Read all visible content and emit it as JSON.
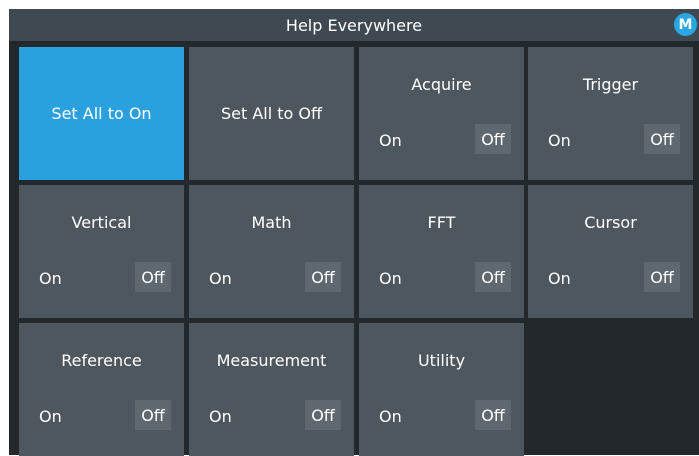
{
  "window": {
    "title": "Help Everywhere",
    "badge": "M"
  },
  "actions": {
    "set_all_on": "Set All to On",
    "set_all_off": "Set All to Off"
  },
  "options": {
    "on": "On",
    "off": "Off"
  },
  "categories": [
    {
      "name": "Acquire",
      "state": "Off"
    },
    {
      "name": "Trigger",
      "state": "Off"
    },
    {
      "name": "Vertical",
      "state": "Off"
    },
    {
      "name": "Math",
      "state": "Off"
    },
    {
      "name": "FFT",
      "state": "Off"
    },
    {
      "name": "Cursor",
      "state": "Off"
    },
    {
      "name": "Reference",
      "state": "Off"
    },
    {
      "name": "Measurement",
      "state": "Off"
    },
    {
      "name": "Utility",
      "state": "Off"
    }
  ],
  "colors": {
    "accent": "#2aa0de",
    "tile": "#4f575e",
    "background": "#22282c",
    "titlebar": "#3f4951"
  }
}
